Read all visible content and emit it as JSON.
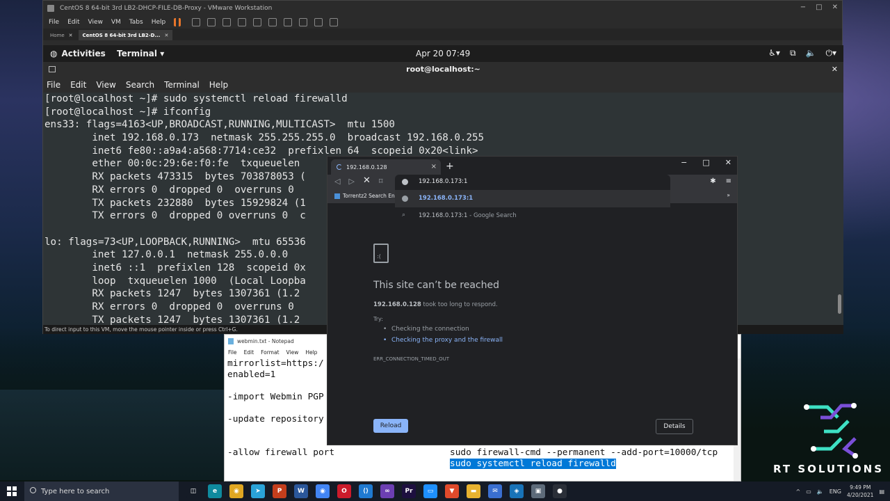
{
  "vmware": {
    "title": "CentOS 8 64-bit 3rd LB2-DHCP-FILE-DB-Proxy - VMware Workstation",
    "menu": [
      "File",
      "Edit",
      "View",
      "VM",
      "Tabs",
      "Help"
    ],
    "tabs": [
      {
        "label": "Home",
        "active": false
      },
      {
        "label": "CentOS 8 64-bit 3rd LB2-D...",
        "active": true
      }
    ],
    "status": "To direct input to this VM, move the mouse pointer inside or press Ctrl+G."
  },
  "gnome": {
    "activities": "Activities",
    "app": "Terminal ▾",
    "clock": "Apr 20  07:49"
  },
  "terminal": {
    "title": "root@localhost:~",
    "menu": [
      "File",
      "Edit",
      "View",
      "Search",
      "Terminal",
      "Help"
    ],
    "lines": [
      "[root@localhost ~]# sudo systemctl reload firewalld",
      "[root@localhost ~]# ifconfig",
      "ens33: flags=4163<UP,BROADCAST,RUNNING,MULTICAST>  mtu 1500",
      "        inet 192.168.0.173  netmask 255.255.255.0  broadcast 192.168.0.255",
      "        inet6 fe80::a9a4:a568:7714:ce32  prefixlen 64  scopeid 0x20<link>",
      "        ether 00:0c:29:6e:f0:fe  txqueuelen",
      "        RX packets 473315  bytes 703878053 (",
      "        RX errors 0  dropped 0  overruns 0",
      "        TX packets 232880  bytes 15929824 (1",
      "        TX errors 0  dropped 0 overruns 0  c",
      "",
      "lo: flags=73<UP,LOOPBACK,RUNNING>  mtu 65536",
      "        inet 127.0.0.1  netmask 255.0.0.0",
      "        inet6 ::1  prefixlen 128  scopeid 0x",
      "        loop  txqueuelen 1000  (Local Loopba",
      "        RX packets 1247  bytes 1307361 (1.2",
      "        RX errors 0  dropped 0  overruns 0",
      "        TX packets 1247  bytes 1307361 (1.2"
    ]
  },
  "notepad": {
    "title": "webmin.txt - Notepad",
    "menu": [
      "File",
      "Edit",
      "Format",
      "View",
      "Help"
    ],
    "lines": [
      {
        "text": "mirrorlist=https:/",
        "col": 0,
        "row": 0
      },
      {
        "text": "enabled=1",
        "col": 0,
        "row": 1
      },
      {
        "text": "-import Webmin PGP",
        "col": 0,
        "row": 3
      },
      {
        "text": "-update repository",
        "col": 0,
        "row": 5
      },
      {
        "text": "-allow firewall port",
        "col": 0,
        "row": 8
      },
      {
        "text": "sudo firewall-cmd --permanent --add-port=10000/tcp",
        "col": 1,
        "row": 8
      },
      {
        "text": "sudo systemctl reload firewalld",
        "col": 1,
        "row": 9,
        "selected": true
      }
    ]
  },
  "chrome": {
    "tab_title": "192.168.0.128",
    "omnibox_value": "192.168.0.173:1",
    "bookmark": "Torrentz2 Search En...",
    "suggestions": [
      {
        "label": "192.168.0.173:1",
        "sub": "",
        "type": "url"
      },
      {
        "label": "192.168.0.173:1",
        "sub": " - Google Search",
        "type": "search"
      }
    ],
    "error": {
      "title": "This site can’t be reached",
      "host": "192.168.0.128",
      "desc_rest": " took too long to respond.",
      "try": "Try:",
      "items": [
        {
          "text": "Checking the connection",
          "link": false
        },
        {
          "text": "Checking the proxy and the firewall",
          "link": true
        }
      ],
      "code": "ERR_CONNECTION_TIMED_OUT",
      "reload": "Reload",
      "details": "Details"
    }
  },
  "brand": {
    "text": "RT SOLUTIONS"
  },
  "taskbar": {
    "search_placeholder": "Type here to search",
    "apps": [
      {
        "name": "task-view-icon",
        "color": "#151b26",
        "glyph": "◫"
      },
      {
        "name": "edge-icon",
        "color": "#0f8a9e",
        "glyph": "e"
      },
      {
        "name": "chrome-icon",
        "color": "#e0a722",
        "glyph": "◉"
      },
      {
        "name": "telegram-icon",
        "color": "#2aa3d8",
        "glyph": "➤"
      },
      {
        "name": "powerpoint-icon",
        "color": "#c43e1c",
        "glyph": "P"
      },
      {
        "name": "word-icon",
        "color": "#2b579a",
        "glyph": "W"
      },
      {
        "name": "chrome-icon-2",
        "color": "#4285f4",
        "glyph": "◉"
      },
      {
        "name": "opera-icon",
        "color": "#cc1b2b",
        "glyph": "O"
      },
      {
        "name": "vscode-icon",
        "color": "#1f7ad1",
        "glyph": "⟨⟩"
      },
      {
        "name": "visual-studio-icon",
        "color": "#6c3fb2",
        "glyph": "∞"
      },
      {
        "name": "premiere-icon",
        "color": "#1d0f3f",
        "glyph": "Pr"
      },
      {
        "name": "explorer-icon",
        "color": "#1e90ff",
        "glyph": "▭"
      },
      {
        "name": "brave-icon",
        "color": "#e04a2b",
        "glyph": "▼"
      },
      {
        "name": "folder-icon",
        "color": "#e8b22f",
        "glyph": "▬"
      },
      {
        "name": "mail-icon",
        "color": "#3a6fd0",
        "glyph": "✉"
      },
      {
        "name": "virtualbox-icon",
        "color": "#1873b8",
        "glyph": "◈"
      },
      {
        "name": "vmware-icon",
        "color": "#5d6b7a",
        "glyph": "▣"
      },
      {
        "name": "github-icon",
        "color": "#2a2f38",
        "glyph": "●"
      }
    ],
    "lang": "ENG",
    "time": "9:49 PM",
    "date": "4/20/2021"
  }
}
